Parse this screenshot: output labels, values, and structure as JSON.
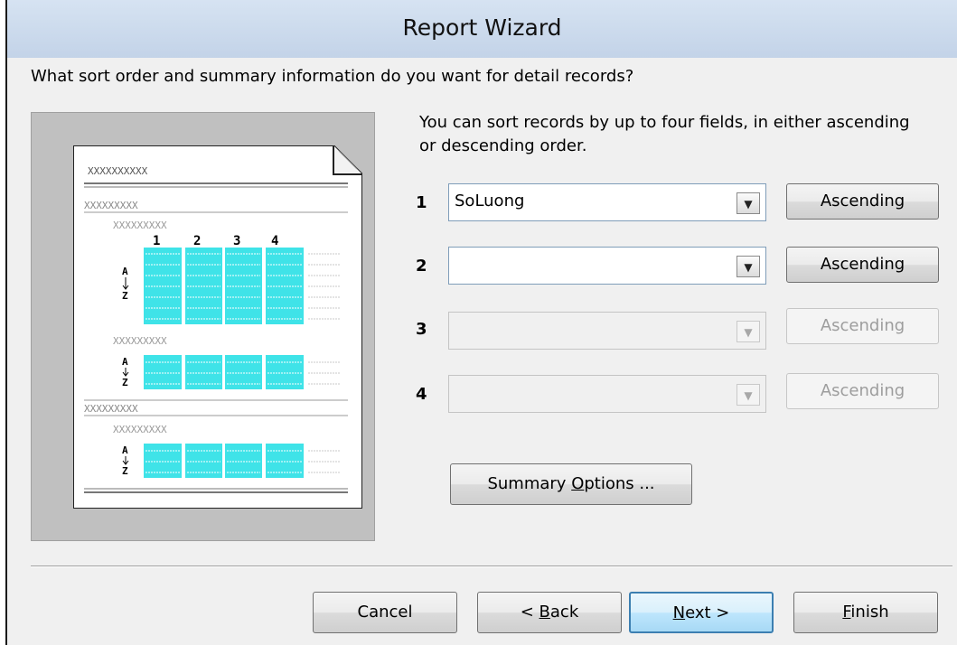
{
  "window": {
    "title": "Report Wizard"
  },
  "question": "What sort order and summary information do you want for detail records?",
  "hint": "You can sort records by up to four fields, in either ascending or descending order.",
  "preview": {
    "placeholder_long": "XXXXXXXXXX",
    "placeholder_mid": "XXXXXXXXX",
    "column_numbers": [
      "1",
      "2",
      "3",
      "4"
    ],
    "cell_text": "XXXX",
    "sort_glyph_top": "A",
    "sort_glyph_bottom": "Z",
    "highlight_color": "#3fe3e8"
  },
  "sort_fields": [
    {
      "number": "1",
      "value": "SoLuong",
      "order": "Ascending",
      "enabled": true
    },
    {
      "number": "2",
      "value": "",
      "order": "Ascending",
      "enabled": true
    },
    {
      "number": "3",
      "value": "",
      "order": "Ascending",
      "enabled": false
    },
    {
      "number": "4",
      "value": "",
      "order": "Ascending",
      "enabled": false
    }
  ],
  "summary_button": {
    "label_pre": "Summary ",
    "label_mnemonic": "O",
    "label_post": "ptions ..."
  },
  "footer": {
    "cancel": "Cancel",
    "back_pre": "< ",
    "back_mnemonic": "B",
    "back_post": "ack",
    "next_mnemonic": "N",
    "next_post": "ext >",
    "finish_mnemonic": "F",
    "finish_post": "inish"
  }
}
